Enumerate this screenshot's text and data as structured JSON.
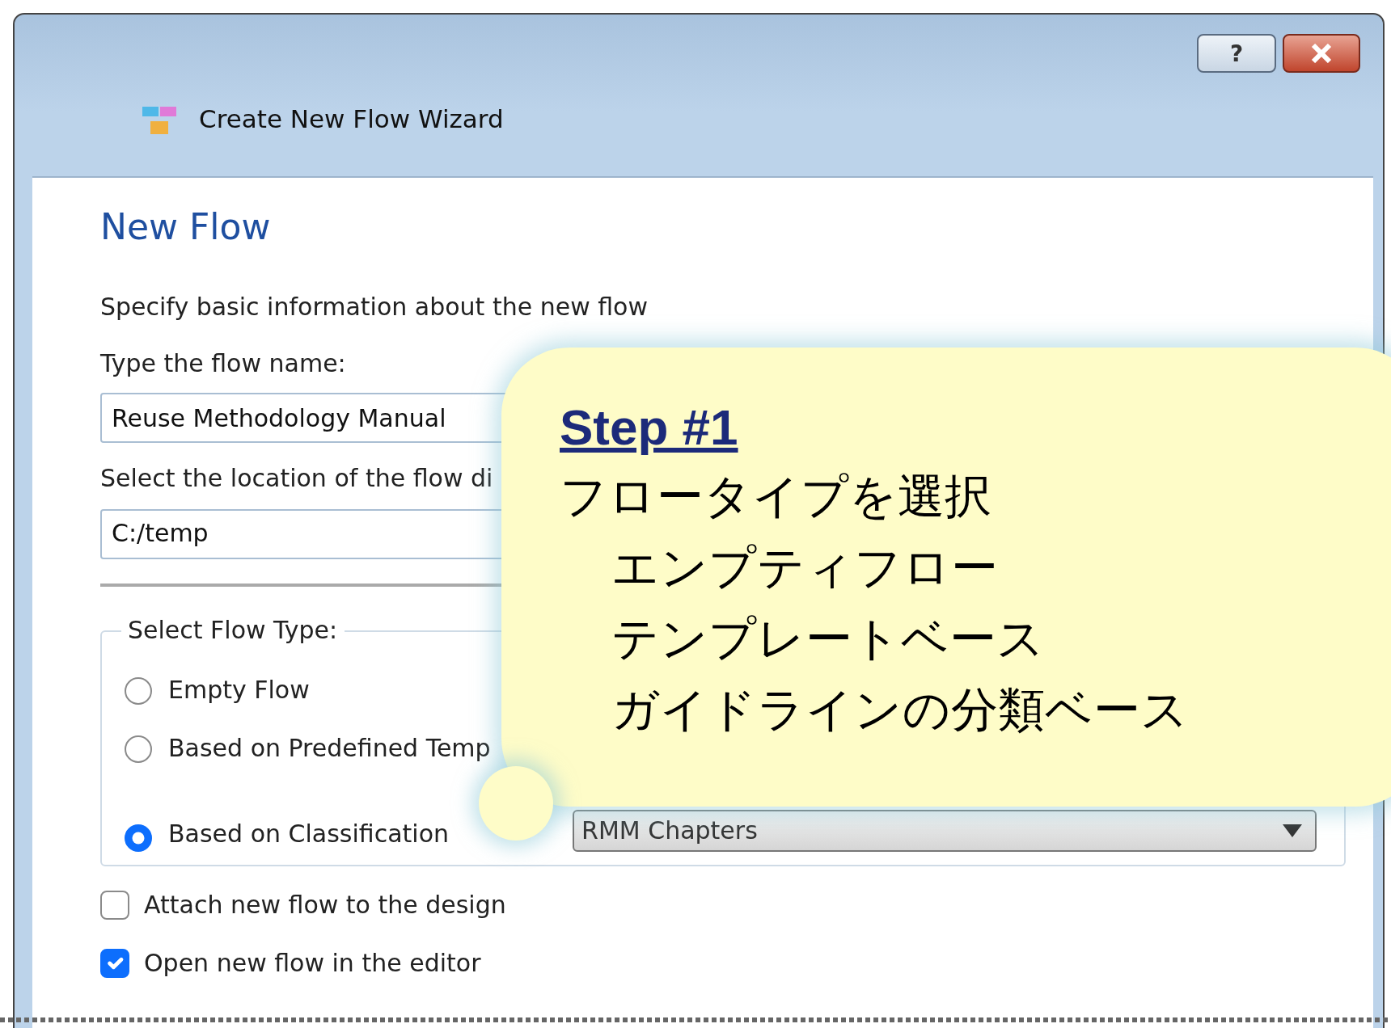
{
  "window": {
    "title": "Create New Flow Wizard",
    "help_button": "?"
  },
  "page": {
    "heading": "New Flow",
    "description": "Specify basic information about the new flow",
    "fields": [
      {
        "label": "Type the flow name:",
        "value": "Reuse Methodology Manual"
      },
      {
        "label": "Select the location of the flow di",
        "value": "C:/temp"
      }
    ],
    "flow_type": {
      "legend": "Select Flow Type:",
      "options": [
        {
          "label": "Empty Flow",
          "selected": false
        },
        {
          "label": "Based on Predefined Temp",
          "selected": false
        },
        {
          "label": "Based on Classification",
          "selected": true
        }
      ],
      "classification": "RMM Chapters"
    },
    "checkboxes": [
      {
        "label": "Attach new flow to the design",
        "checked": false
      },
      {
        "label": "Open new flow in the editor",
        "checked": true
      }
    ]
  },
  "callout": {
    "title": "Step #1",
    "lines": [
      {
        "text": "フロータイプを選択",
        "indented": false
      },
      {
        "text": "エンプティフロー",
        "indented": true
      },
      {
        "text": "テンプレートベース",
        "indented": true
      },
      {
        "text": "ガイドラインの分類ベース",
        "indented": true
      }
    ]
  }
}
